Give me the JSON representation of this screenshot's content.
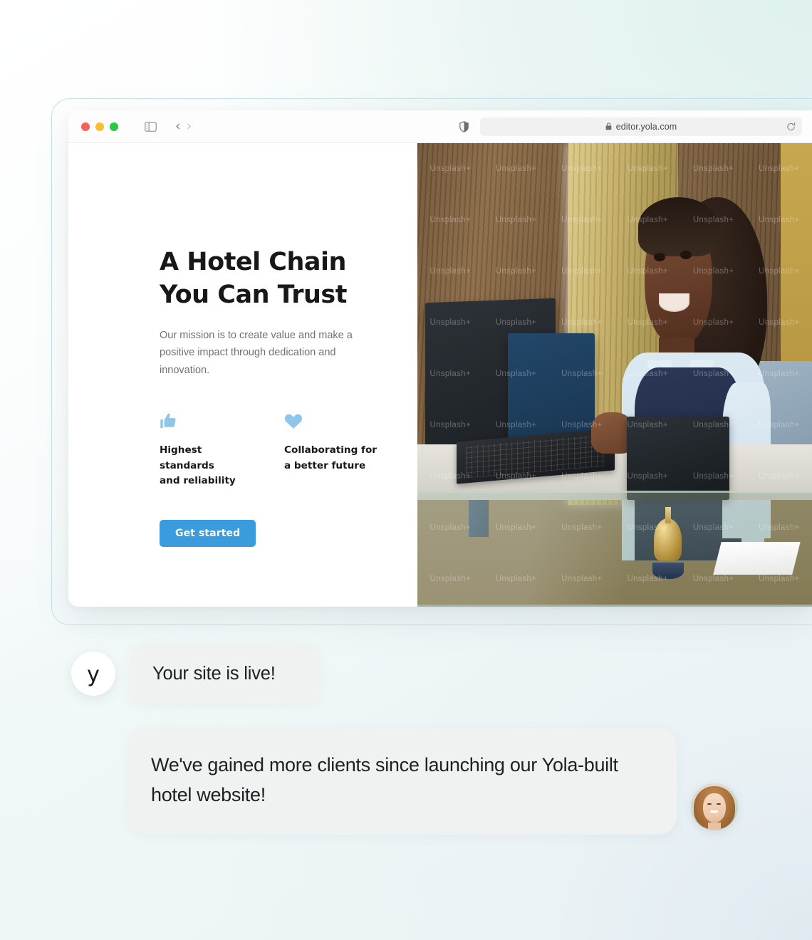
{
  "browser": {
    "url": "editor.yola.com",
    "lock_icon": "lock-icon",
    "reload_icon": "reload-icon",
    "sidebar_toggle_icon": "sidebar-toggle-icon",
    "back_icon": "chevron-left-icon",
    "forward_icon": "chevron-right-icon",
    "shield_icon": "shield-icon",
    "traffic_lights": {
      "close": "#ff5f57",
      "minimize": "#febc2e",
      "maximize": "#28c840"
    }
  },
  "site": {
    "hero": {
      "title": "A Hotel Chain\nYou Can Trust",
      "subtitle": "Our mission is to create value and make a positive impact through dedication and innovation.",
      "cta_label": "Get started",
      "cta_color": "#3a9bdd"
    },
    "features": [
      {
        "icon": "thumbs-up-icon",
        "label": "Highest standards\nand reliability",
        "icon_color": "#8ec6ea"
      },
      {
        "icon": "heart-icon",
        "label": "Collaborating for\na better future",
        "icon_color": "#8ec6ea"
      }
    ],
    "photo": {
      "alt": "hotel-receptionist-photo",
      "watermark": "Unsplash+"
    }
  },
  "chat": {
    "messages": [
      {
        "avatar": "yola-logo-avatar",
        "avatar_mark": "y",
        "text": "Your site is live!"
      },
      {
        "avatar": "client-photo-avatar",
        "text": "We've gained more clients since launching our Yola-built hotel website!"
      }
    ]
  }
}
